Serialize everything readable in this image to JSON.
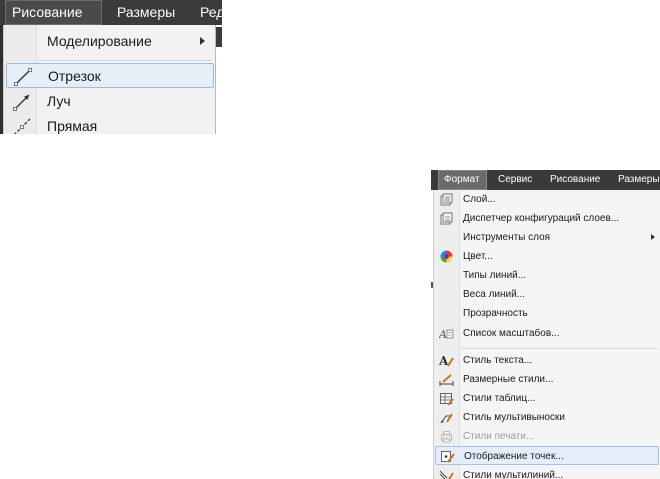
{
  "left_menu": {
    "menubar": [
      {
        "label": "Рисование",
        "active": true
      },
      {
        "label": "Размеры",
        "active": false
      },
      {
        "label": "Ред",
        "active": false
      }
    ],
    "items": [
      {
        "label": "Моделирование",
        "icon": "none",
        "submenu": true,
        "highlighted": false
      },
      {
        "label": "Отрезок",
        "icon": "line-segment-icon",
        "submenu": false,
        "highlighted": true
      },
      {
        "label": "Луч",
        "icon": "ray-icon",
        "submenu": false,
        "highlighted": false
      },
      {
        "label": "Прямая",
        "icon": "construction-line-icon",
        "submenu": false,
        "highlighted": false
      }
    ]
  },
  "right_menu": {
    "menubar": [
      {
        "label": "Формат",
        "active": true
      },
      {
        "label": "Сервис",
        "active": false
      },
      {
        "label": "Рисование",
        "active": false
      },
      {
        "label": "Размеры",
        "active": false
      }
    ],
    "items": [
      {
        "label": "Слой...",
        "icon": "layer-icon"
      },
      {
        "label": "Диспетчер конфигураций слоев...",
        "icon": "layer-states-icon"
      },
      {
        "label": "Инструменты слоя",
        "icon": "none",
        "submenu": true
      },
      {
        "label": "Цвет...",
        "icon": "color-wheel-icon"
      },
      {
        "label": "Типы линий...",
        "icon": "none"
      },
      {
        "label": "Веса линий...",
        "icon": "none"
      },
      {
        "label": "Прозрачность",
        "icon": "none"
      },
      {
        "label": "Список масштабов...",
        "icon": "scale-list-icon"
      },
      {
        "label": "Стиль текста...",
        "icon": "text-style-icon"
      },
      {
        "label": "Размерные стили...",
        "icon": "dimension-style-icon"
      },
      {
        "label": "Стили таблиц...",
        "icon": "table-style-icon"
      },
      {
        "label": "Стиль мультивыноски",
        "icon": "multileader-style-icon"
      },
      {
        "label": "Стили печати...",
        "icon": "plot-style-icon",
        "disabled": true
      },
      {
        "label": "Отображение точек...",
        "icon": "point-style-icon",
        "highlighted": true
      },
      {
        "label": "Стили мультилиний...",
        "icon": "multiline-style-icon"
      }
    ]
  },
  "colors": {
    "menubar_bg": "#3b3b3b",
    "menu_bg": "#f2f2f2",
    "highlight_bg": "#e6eef8",
    "highlight_border": "#9dbbe0",
    "disabled_text": "#9a9a9a"
  }
}
